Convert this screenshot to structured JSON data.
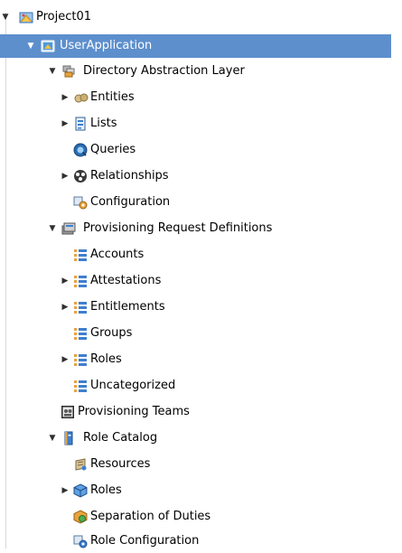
{
  "tree": {
    "project": {
      "label": "Project01",
      "icon": "project-icon"
    },
    "user_application": {
      "label": "UserApplication",
      "icon": "app-icon"
    },
    "dal": {
      "label": "Directory Abstraction Layer",
      "icon": "dal-icon",
      "entities": "Entities",
      "lists": "Lists",
      "queries": "Queries",
      "relationships": "Relationships",
      "configuration": "Configuration"
    },
    "prd": {
      "label": "Provisioning Request Definitions",
      "icon": "prd-icon",
      "accounts": "Accounts",
      "attestations": "Attestations",
      "entitlements": "Entitlements",
      "groups": "Groups",
      "roles": "Roles",
      "uncategorized": "Uncategorized"
    },
    "provisioning_teams": "Provisioning Teams",
    "role_catalog": {
      "label": "Role Catalog",
      "icon": "role-catalog-icon",
      "resources": "Resources",
      "roles": "Roles",
      "sod": "Separation of Duties",
      "role_configuration": "Role Configuration"
    }
  },
  "colors": {
    "selection": "#5d8fcd",
    "accent_orange": "#e8a33c",
    "accent_blue": "#3e7fd1"
  }
}
